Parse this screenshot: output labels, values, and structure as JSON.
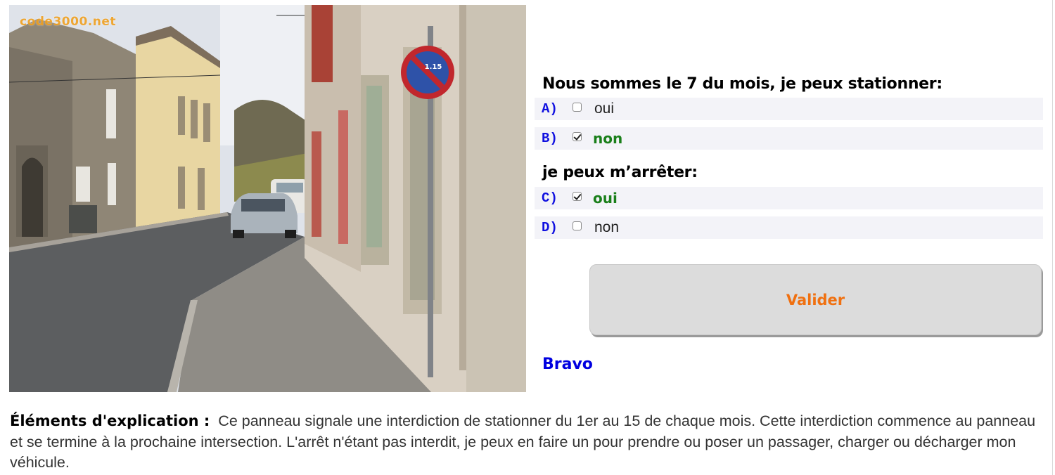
{
  "photo": {
    "watermark": "code3000.net",
    "sign_text": "1.15"
  },
  "question1": {
    "title": "Nous sommes le 7 du mois, je peux stationner:",
    "options": [
      {
        "letter": "A)",
        "label": "oui",
        "checked": false,
        "correct": false
      },
      {
        "letter": "B)",
        "label": "non",
        "checked": true,
        "correct": true
      }
    ]
  },
  "question2": {
    "title": "je peux m’arrêter:",
    "options": [
      {
        "letter": "C)",
        "label": "oui",
        "checked": true,
        "correct": true
      },
      {
        "letter": "D)",
        "label": "non",
        "checked": false,
        "correct": false
      }
    ]
  },
  "validate_label": "Valider",
  "result": "Bravo",
  "explanation": {
    "heading": "Éléments d'explication :",
    "text": "Ce panneau signale une interdiction de stationner du 1er au 15 de chaque mois. Cette interdiction commence au panneau et se termine à la prochaine intersection. L'arrêt n'étant pas interdit, je peux en faire un pour prendre ou poser un passager, charger ou décharger mon véhicule."
  },
  "colors": {
    "option_letter": "#1010e0",
    "correct": "#1a7f1a",
    "validate_text": "#f07010",
    "result": "#0000e0"
  }
}
